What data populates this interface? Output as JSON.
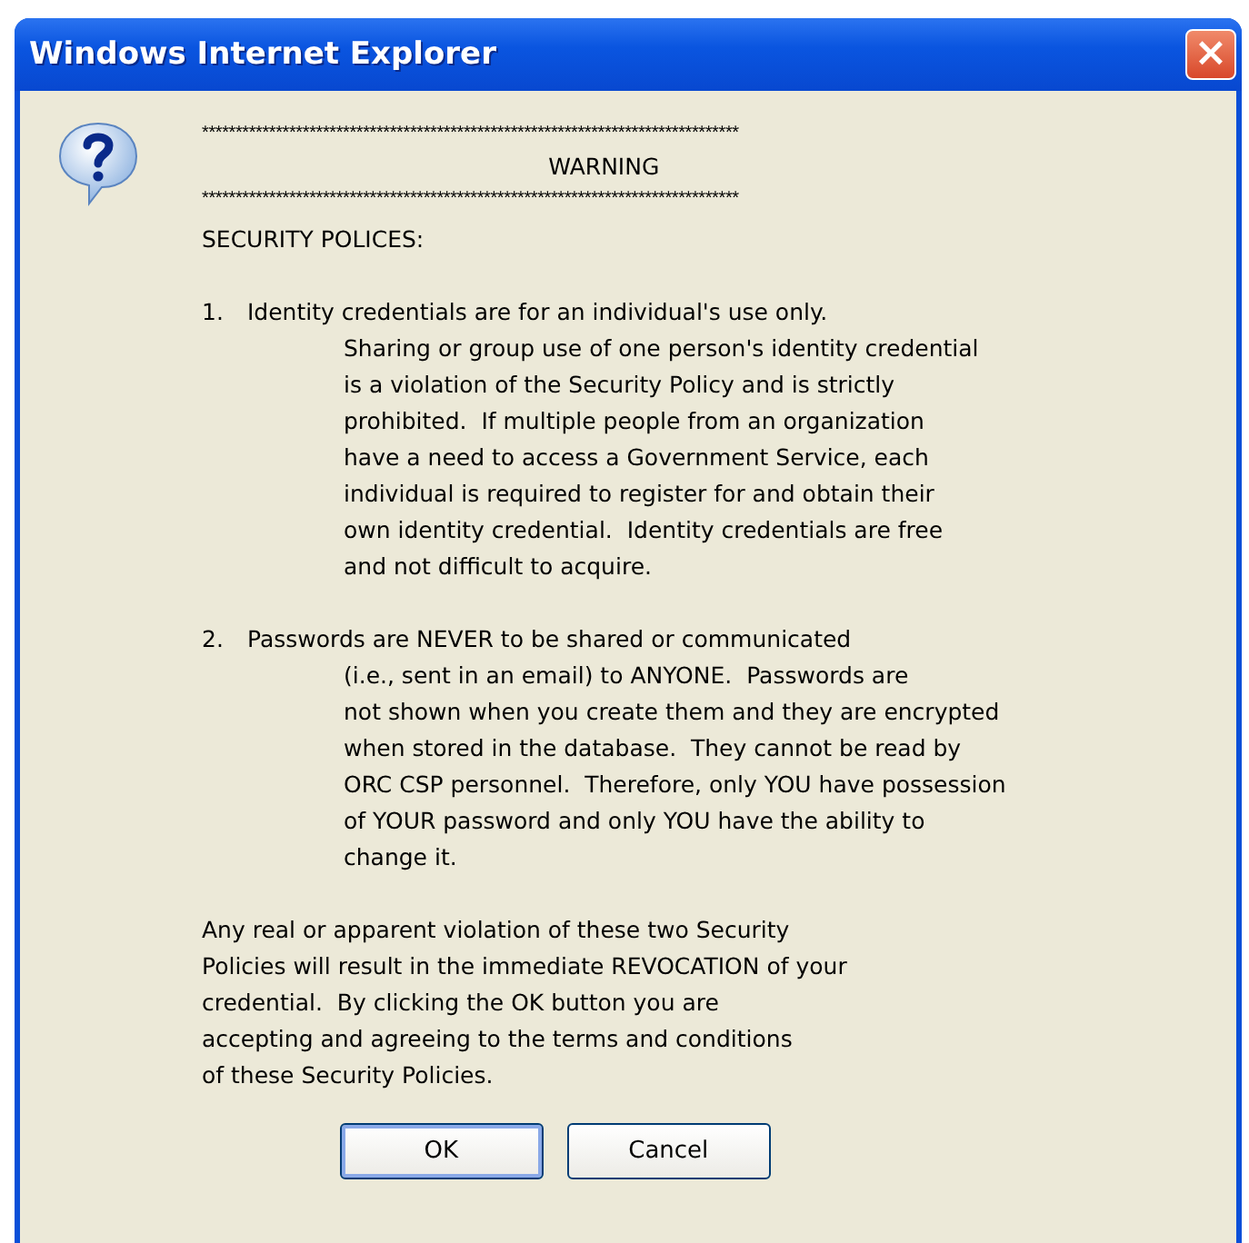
{
  "window": {
    "title": "Windows Internet Explorer",
    "close": "×"
  },
  "header": {
    "rule_top": "********************************************************************************",
    "heading": "WARNING",
    "rule_bottom": "********************************************************************************"
  },
  "message_lines": [
    {
      "kind": "plain",
      "text": "SECURITY POLICES:"
    },
    {
      "kind": "gap"
    },
    {
      "kind": "item",
      "number": "1.",
      "text": "Identity credentials are for an individual's use only."
    },
    {
      "kind": "continuation",
      "text": "Sharing or group use of one person's identity credential"
    },
    {
      "kind": "continuation",
      "text": "is a violation of the Security Policy and is strictly"
    },
    {
      "kind": "continuation",
      "text": "prohibited.  If multiple people from an organization"
    },
    {
      "kind": "continuation",
      "text": "have a need to access a Government Service, each"
    },
    {
      "kind": "continuation",
      "text": "individual is required to register for and obtain their"
    },
    {
      "kind": "continuation",
      "text": "own identity credential.  Identity credentials are free"
    },
    {
      "kind": "continuation",
      "text": "and not difficult to acquire."
    },
    {
      "kind": "gap"
    },
    {
      "kind": "item",
      "number": "2.",
      "text": "Passwords are NEVER to be shared or communicated"
    },
    {
      "kind": "continuation",
      "text": "(i.e., sent in an email) to ANYONE.  Passwords are"
    },
    {
      "kind": "continuation",
      "text": "not shown when you create them and they are encrypted"
    },
    {
      "kind": "continuation",
      "text": "when stored in the database.  They cannot be read by"
    },
    {
      "kind": "continuation",
      "text": "ORC CSP personnel.  Therefore, only YOU have possession"
    },
    {
      "kind": "continuation",
      "text": "of YOUR password and only YOU have the ability to"
    },
    {
      "kind": "continuation",
      "text": "change it."
    },
    {
      "kind": "gap"
    },
    {
      "kind": "plain",
      "text": "Any real or apparent violation of these two Security"
    },
    {
      "kind": "plain",
      "text": "Policies will result in the immediate REVOCATION of your"
    },
    {
      "kind": "plain",
      "text": "credential.  By clicking the OK button you are"
    },
    {
      "kind": "plain",
      "text": "accepting and agreeing to the terms and conditions"
    },
    {
      "kind": "plain",
      "text": "of these Security Policies."
    }
  ],
  "buttons": [
    {
      "label": "OK",
      "selected": true
    },
    {
      "label": "Cancel",
      "selected": false
    }
  ]
}
